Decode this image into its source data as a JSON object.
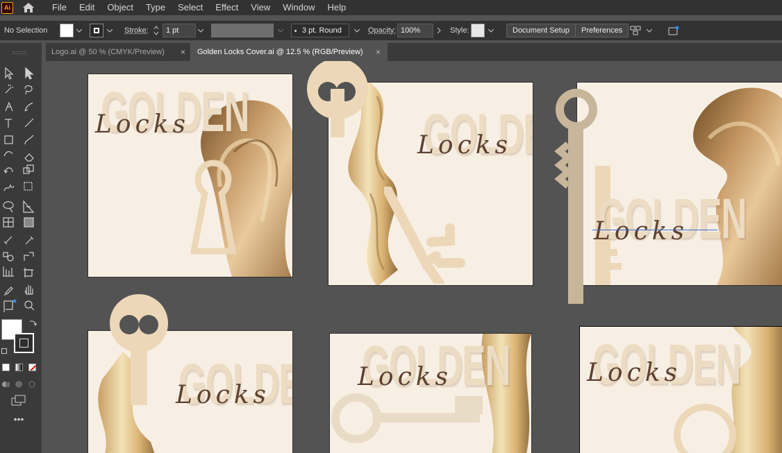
{
  "menu": {
    "app_logo": "Ai",
    "items": [
      "File",
      "Edit",
      "Object",
      "Type",
      "Select",
      "Effect",
      "View",
      "Window",
      "Help"
    ]
  },
  "control": {
    "selection": "No Selection",
    "stroke_label": "Stroke:",
    "stroke_value": "1 pt",
    "brush_label": "3 pt. Round",
    "opacity_label": "Opacity:",
    "opacity_value": "100%",
    "style_label": "Style:",
    "doc_setup": "Document Setup",
    "preferences": "Preferences"
  },
  "tabs": [
    {
      "label": "Logo.ai @ 50 % (CMYK/Preview)",
      "close": "×",
      "active": false
    },
    {
      "label": "Golden Locks Cover.ai @ 12.5 % (RGB/Preview)",
      "close": "×",
      "active": true
    }
  ],
  "tools": [
    "selection-tool",
    "direct-selection-tool",
    "magic-wand-tool",
    "lasso-tool",
    "pen-tool",
    "curvature-tool",
    "type-tool",
    "line-tool",
    "rectangle-tool",
    "paintbrush-tool",
    "shaper-tool",
    "eraser-tool",
    "rotate-tool",
    "scale-tool",
    "warp-tool",
    "free-transform-tool",
    "shape-builder-tool",
    "perspective-grid-tool",
    "mesh-tool",
    "gradient-tool",
    "eyedropper-tool",
    "blend-tool",
    "symbol-sprayer-tool",
    "slice-tool",
    "column-graph-tool",
    "artboard-tool",
    "hand-tool",
    "zoom-tool",
    "more-tools"
  ],
  "artboards": [
    {
      "title": "GOLDEN",
      "script": "Locks"
    },
    {
      "title": "GOLDEN",
      "script": "Locks"
    },
    {
      "title": "GOLDEN",
      "script": "Locks"
    },
    {
      "title": "GOLDEN",
      "script": "Locks"
    },
    {
      "title": "GOLDEN",
      "script": "Locks"
    },
    {
      "title": "GOLDEN",
      "script": "Locks"
    }
  ],
  "colors": {
    "accent": "#ff9a00",
    "artboard_bg": "#f8efe4",
    "gold_text": "#ecdcc4",
    "script_text": "#5c4030",
    "key": "#ecd8b8"
  }
}
